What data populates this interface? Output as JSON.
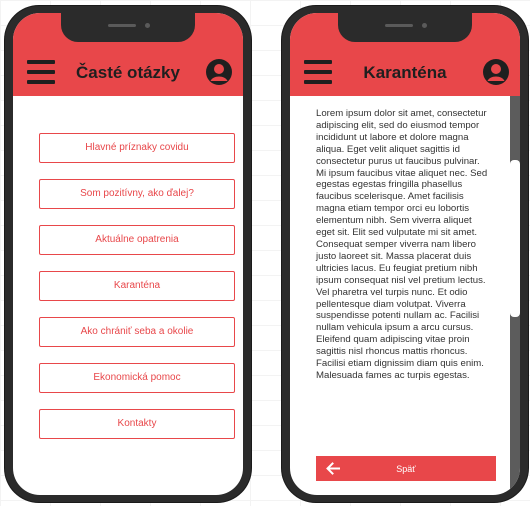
{
  "left_screen": {
    "title": "Časté otázky",
    "menu_items": [
      "Hlavné príznaky covidu",
      "Som pozitívny, ako ďalej?",
      "Aktuálne opatrenia",
      "Karanténa",
      "Ako chrániť seba a okolie",
      "Ekonomická pomoc",
      "Kontakty"
    ]
  },
  "right_screen": {
    "title": "Karanténa",
    "body_text": "Lorem ipsum dolor sit amet, consectetur adipiscing elit, sed do eiusmod tempor incididunt ut labore et dolore magna aliqua. Eget velit aliquet sagittis id consectetur purus ut faucibus pulvinar. Mi ipsum faucibus vitae aliquet nec. Sed egestas egestas fringilla phasellus faucibus scelerisque. Amet facilisis magna etiam tempor orci eu lobortis elementum nibh. Sem viverra aliquet eget sit. Elit sed vulputate mi sit amet. Consequat semper viverra nam libero justo laoreet sit. Massa placerat duis ultricies lacus. Eu feugiat pretium nibh ipsum consequat nisl vel pretium lectus. Vel pharetra vel turpis nunc. Et odio pellentesque diam volutpat. Viverra suspendisse potenti nullam ac. Facilisi nullam vehicula ipsum a arcu cursus. Eleifend quam adipiscing vitae proin sagittis nisl rhoncus mattis rhoncus. Facilisi etiam dignissim diam quis enim. Malesuada fames ac turpis egestas.",
    "back_label": "Späť"
  },
  "icons": {
    "menu": "hamburger-icon",
    "profile": "user-circle-icon",
    "back": "arrow-left-icon"
  },
  "colors": {
    "accent": "#e8474a",
    "phone_frame": "#2b2b2b",
    "icon_dark": "#1f1f1f"
  }
}
